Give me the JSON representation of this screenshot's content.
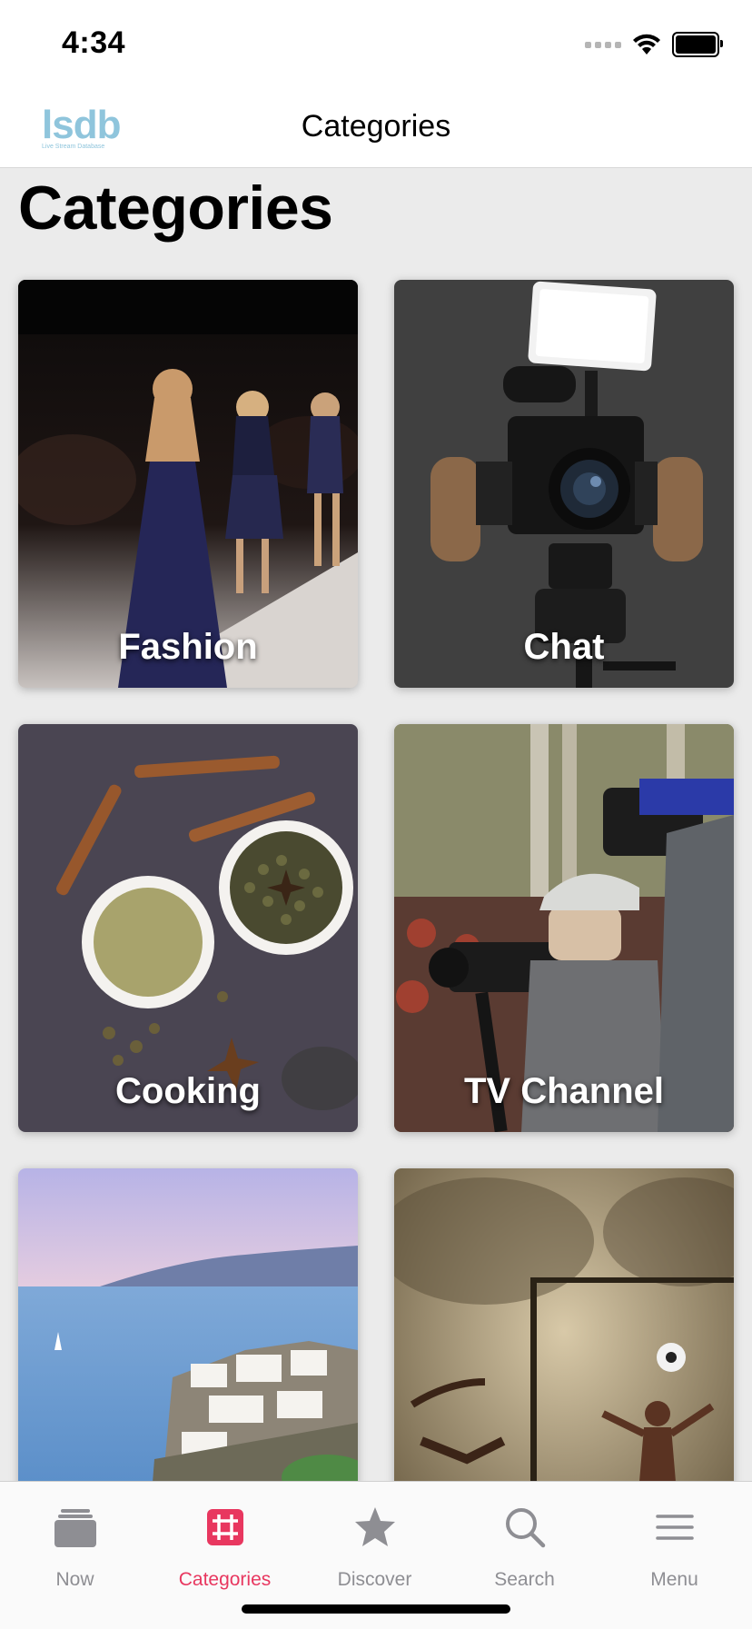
{
  "status_bar": {
    "time": "4:34"
  },
  "nav_bar": {
    "logo_text": "lsdb",
    "logo_subtitle": "Live Stream Database",
    "title": "Categories"
  },
  "page": {
    "heading": "Categories"
  },
  "categories": [
    {
      "label": "Fashion",
      "image": "runway-models"
    },
    {
      "label": "Chat",
      "image": "camera-rig"
    },
    {
      "label": "Cooking",
      "image": "spices"
    },
    {
      "label": "TV Channel",
      "image": "news-cameras"
    },
    {
      "label": "",
      "image": "coastal-village"
    },
    {
      "label": "",
      "image": "street-football"
    }
  ],
  "tab_bar": {
    "tabs": [
      {
        "label": "Now",
        "icon": "stack-icon"
      },
      {
        "label": "Categories",
        "icon": "grid-hash-icon",
        "active": true
      },
      {
        "label": "Discover",
        "icon": "star-icon"
      },
      {
        "label": "Search",
        "icon": "search-icon"
      },
      {
        "label": "Menu",
        "icon": "hamburger-icon"
      }
    ]
  },
  "colors": {
    "accent": "#e8375f",
    "inactive": "#8e8e93",
    "logo": "#8fc5dc",
    "background": "#ebebeb"
  }
}
